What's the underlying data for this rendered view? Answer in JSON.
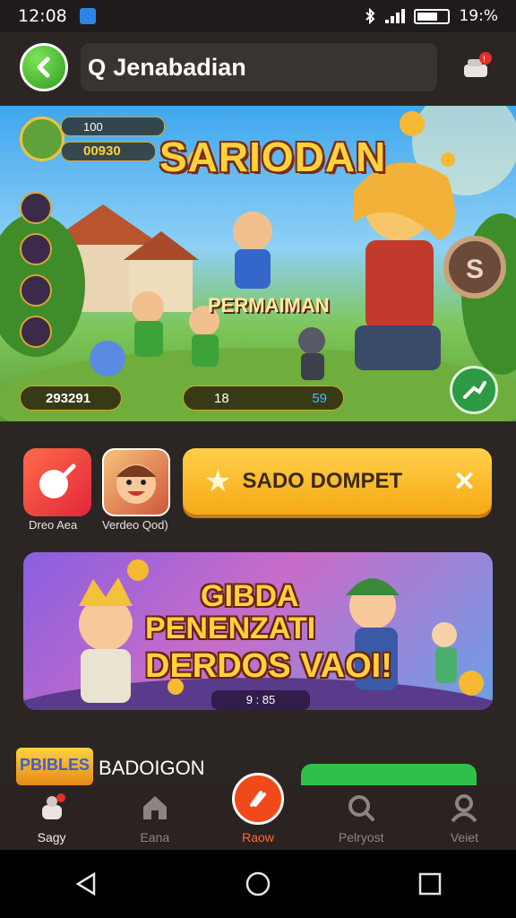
{
  "status_bar": {
    "time": "12:08",
    "right_text": "19:%",
    "icons": [
      "bluetooth-icon",
      "signal-icon",
      "battery-icon"
    ]
  },
  "top_bar": {
    "search_text": "Jenabadian",
    "back_icon": "chevron-left-icon",
    "search_icon": "search-icon",
    "notification_icon": "bell-icon"
  },
  "hero": {
    "title": "SARIODAN",
    "subtitle": "PERMAIMAN",
    "stat_top": "100",
    "stat_coins": "00930",
    "bar_left": "293291",
    "bar_mid": "18",
    "bar_mid_right": "59"
  },
  "quick_actions": {
    "tile1_label": "Dreo Aea",
    "tile2_label": "Verdeo Qod)",
    "promo_label": "SADO DOMPET",
    "promo_close": "✕",
    "promo_star": "★"
  },
  "banner": {
    "line1": "GIBDA",
    "line2": "PENENZATI",
    "line3": "DERDOS VAOI!",
    "counter": "9 : 85"
  },
  "game_row": {
    "logo_text": "PBIBLES",
    "name": "BADOIGON"
  },
  "tabs": [
    {
      "label": "Sagy",
      "icon": "joystick-icon"
    },
    {
      "label": "Eana",
      "icon": "home-icon"
    },
    {
      "label": "Raow",
      "icon": "lightning-icon"
    },
    {
      "label": "Pelryost",
      "icon": "search-icon"
    },
    {
      "label": "Veiet",
      "icon": "user-icon"
    }
  ],
  "colors": {
    "accent": "#f04a1a",
    "promo": "#f6a915",
    "back_button": "#2e9d1e"
  }
}
